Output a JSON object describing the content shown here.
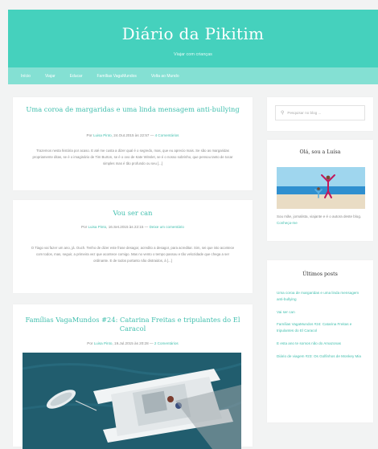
{
  "site": {
    "title": "Diário da Pikitim",
    "tagline": "Viajar com crianças"
  },
  "nav": {
    "items": [
      "Início",
      "Viajar",
      "Educar",
      "Famílias VagaMundos",
      "Volta ao Mundo"
    ]
  },
  "posts": [
    {
      "title": "Uma coroa de margaridas e uma linda mensagem anti-bullying",
      "meta_prefix": "Por",
      "author": "Luisa Pinto",
      "date": "24.Out.2015 às 22:57",
      "sep": "—",
      "comments": "4 Comentários",
      "excerpt": "Trazemos nesta história por acaso. E até me custa a dizer qual é o segredo, mas, que eu aprecio mais. Se são as margaridas propriamente ditas, se é o imaginário de Tim Burton, se é o ovo de Kate Winslet, se é o nosso sobrinho, que pensou tanto de tocar simples mas é tão profundo ou seu [...]"
    },
    {
      "title": "Vou ser can",
      "meta_prefix": "Por",
      "author": "Luisa Pinto",
      "date": "16.Set.2015 às 22:15",
      "sep": "—",
      "comments": "Deixe um comentário",
      "excerpt": "O Tiago vai fazer um ano, já. Ouch. Tenho de dizer este frase desagor, acredito a desagor, para acreditar. Sim, sei que isto acontece com todos, mas, seguir, a primeira vez que acontece comigo. Mas no vento o tempo passou e tão velozidade que chega a ser ordinante. E de todos portanto não distraidos, á [...]"
    },
    {
      "title": "Famílias VagaMundos #24: Catarina Freitas e tripulantes do El Caracol",
      "meta_prefix": "Por",
      "author": "Luisa Pinto",
      "date": "19.Jul.2015 às 20:28",
      "sep": "—",
      "comments": "2 Comentários"
    }
  ],
  "sidebar": {
    "search_placeholder": "Pesquisar no blog ...",
    "about": {
      "title": "Olá, sou a Luísa",
      "text": "Sou mãe, jornalista, viajante e é o autora deste blog.",
      "link": "Conheça-me"
    },
    "recent": {
      "title": "Últimos posts",
      "items": [
        "Uma coroa de margaridas e uma linda mensagem anti-bullying",
        "Vai ser can",
        "Famílias VagaMundos #24: Catarina Freitas e tripulantes do El Caracol",
        "E esta ano te somos não do Amazonas",
        "Diário de viagem #23: Os Golfinhos de Monkey Mia"
      ]
    }
  },
  "colors": {
    "header": "#45d1bd",
    "nav": "#84e0d3",
    "accent": "#41bfae",
    "background": "#f2f3f3"
  },
  "icons": {
    "search": "search-icon"
  }
}
